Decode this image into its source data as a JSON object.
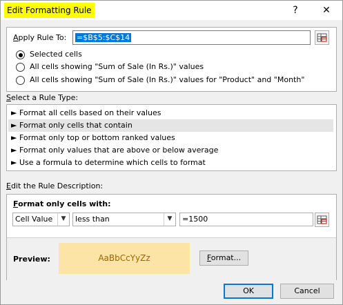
{
  "window": {
    "title": "Edit Formatting Rule",
    "help_glyph": "?",
    "close_glyph": "✕"
  },
  "apply_rule": {
    "label_prefix": "A",
    "label_rest": "pply Rule To:",
    "value": "=$B$5:$C$14",
    "radios": [
      {
        "label": "Selected cells",
        "checked": true
      },
      {
        "label": "All cells showing \"Sum of Sale (In Rs.)\" values",
        "checked": false
      },
      {
        "label": "All cells showing \"Sum of Sale (In Rs.)\" values for \"Product\" and \"Month\"",
        "checked": false
      }
    ]
  },
  "rule_type": {
    "label_prefix": "S",
    "label_rest": "elect a Rule Type:",
    "items": [
      "► Format all cells based on their values",
      "► Format only cells that contain",
      "► Format only top or bottom ranked values",
      "► Format only values that are above or below average",
      "► Use a formula to determine which cells to format"
    ],
    "selected_index": 1
  },
  "description": {
    "label_prefix": "E",
    "label_rest": "dit the Rule Description:",
    "heading_prefix": "F",
    "heading_rest": "ormat only cells with:",
    "field_type": "Cell Value",
    "operator": "less than",
    "value": "=1500",
    "preview_label": "Preview:",
    "preview_text": "AaBbCcYyZz",
    "preview_bg": "#fce4a6",
    "preview_fg": "#9c6500",
    "format_button_prefix": "F",
    "format_button_rest": "ormat..."
  },
  "footer": {
    "ok": "OK",
    "cancel": "Cancel"
  }
}
